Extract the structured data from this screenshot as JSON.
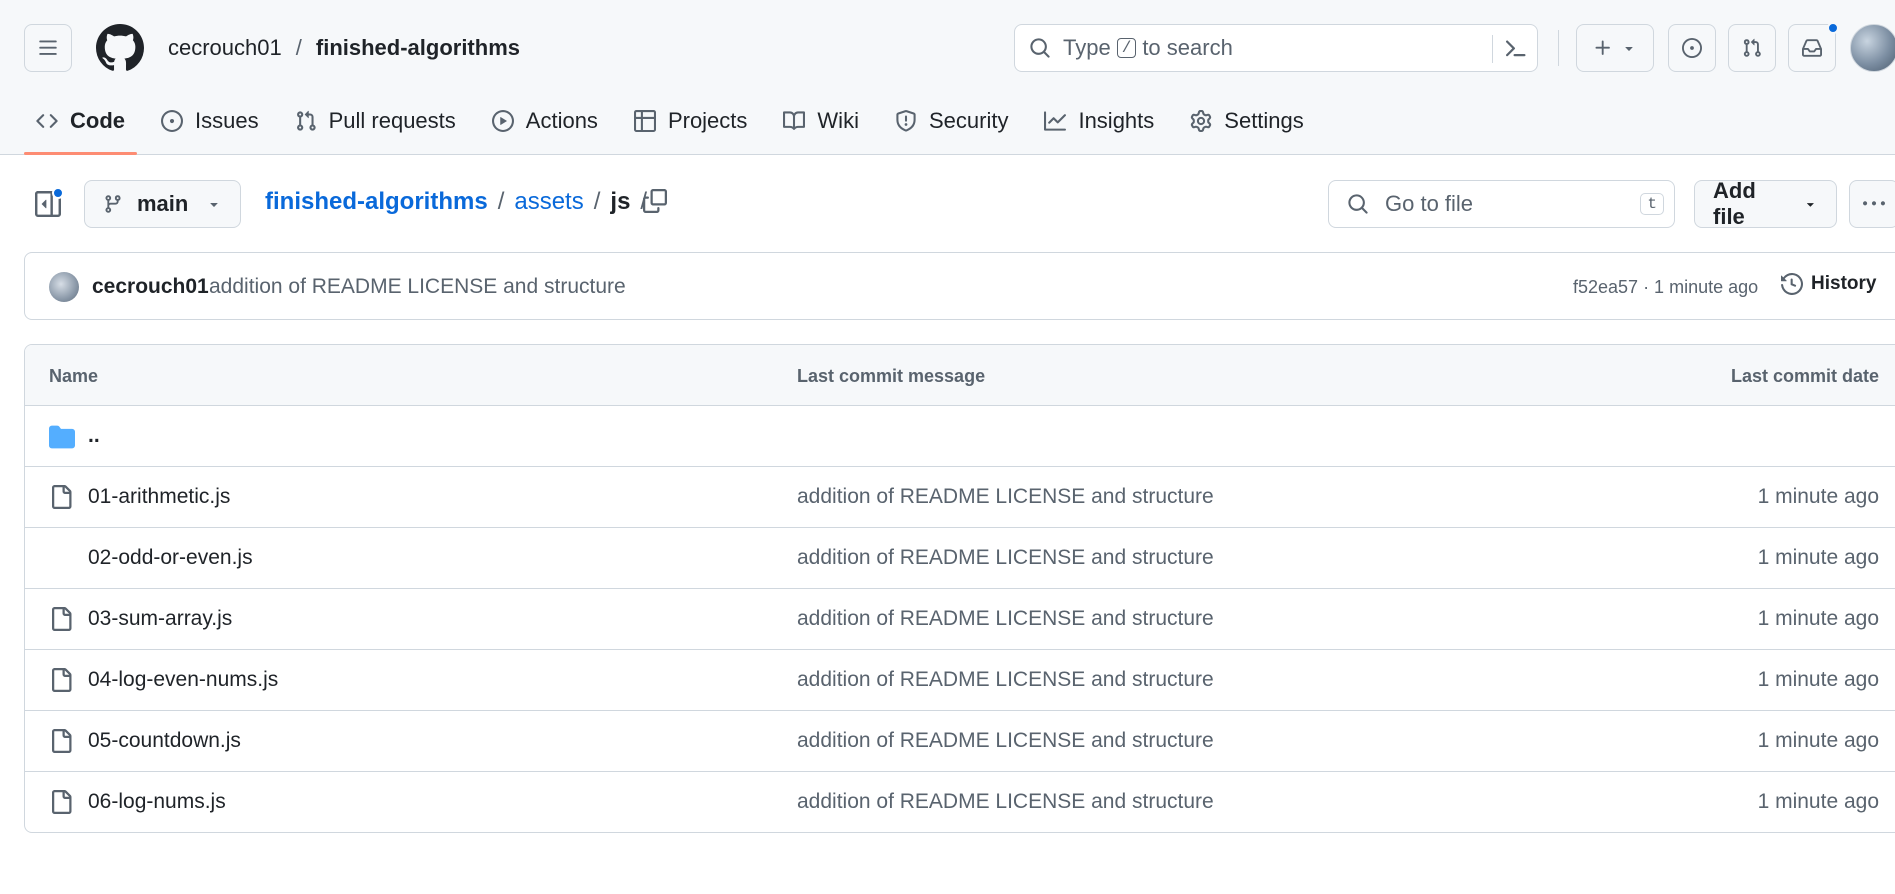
{
  "header": {
    "owner": "cecrouch01",
    "separator": "/",
    "repo": "finished-algorithms",
    "search": {
      "prefix": "Type",
      "key": "/",
      "suffix": "to search"
    }
  },
  "tabs": [
    {
      "label": "Code",
      "icon": "code-icon",
      "active": true
    },
    {
      "label": "Issues",
      "icon": "issue-opened-icon"
    },
    {
      "label": "Pull requests",
      "icon": "git-pull-request-icon"
    },
    {
      "label": "Actions",
      "icon": "play-icon"
    },
    {
      "label": "Projects",
      "icon": "table-icon"
    },
    {
      "label": "Wiki",
      "icon": "book-icon"
    },
    {
      "label": "Security",
      "icon": "shield-icon"
    },
    {
      "label": "Insights",
      "icon": "graph-icon"
    },
    {
      "label": "Settings",
      "icon": "gear-icon"
    }
  ],
  "toolbar": {
    "branch": "main",
    "path": {
      "root": "finished-algorithms",
      "sep": "/",
      "folder": "assets",
      "current": "js"
    },
    "goto_placeholder": "Go to file",
    "goto_key": "t",
    "add_file": "Add file"
  },
  "commit": {
    "author": "cecrouch01",
    "message": "addition of README LICENSE and structure",
    "meta": "f52ea57 · 1 minute ago",
    "history": "History"
  },
  "table": {
    "headers": {
      "name": "Name",
      "message": "Last commit message",
      "date": "Last commit date"
    },
    "parent": "..",
    "rows": [
      {
        "name": "01-arithmetic.js",
        "message": "addition of README LICENSE and structure",
        "date": "1 minute ago"
      },
      {
        "name": "02-odd-or-even.js",
        "message": "addition of README LICENSE and structure",
        "date": "1 minute ago"
      },
      {
        "name": "03-sum-array.js",
        "message": "addition of README LICENSE and structure",
        "date": "1 minute ago"
      },
      {
        "name": "04-log-even-nums.js",
        "message": "addition of README LICENSE and structure",
        "date": "1 minute ago"
      },
      {
        "name": "05-countdown.js",
        "message": "addition of README LICENSE and structure",
        "date": "1 minute ago"
      },
      {
        "name": "06-log-nums.js",
        "message": "addition of README LICENSE and structure",
        "date": "1 minute ago"
      }
    ]
  },
  "colors": {
    "accent": "#0969da",
    "tab_underline": "#fd8c73",
    "folder": "#54aeff",
    "border": "#d0d7de",
    "muted": "#59636e"
  }
}
